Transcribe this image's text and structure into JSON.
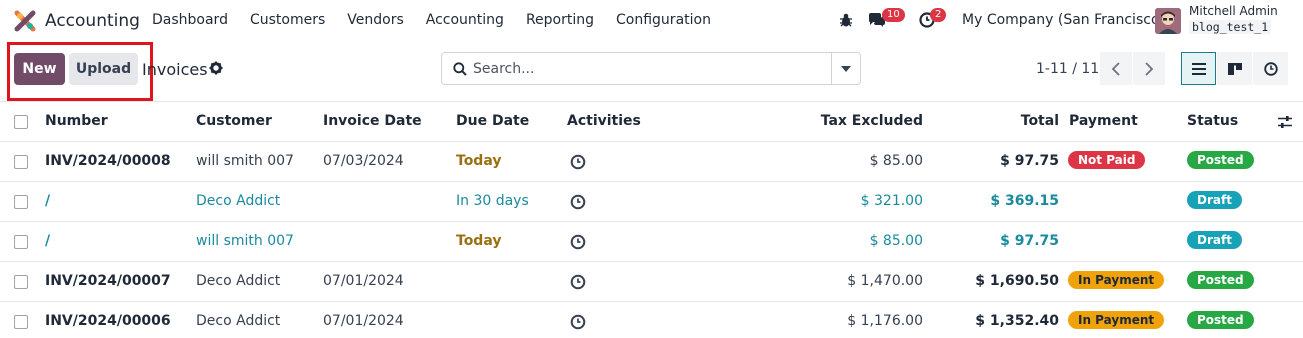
{
  "navbar": {
    "app_name": "Accounting",
    "menu": [
      "Dashboard",
      "Customers",
      "Vendors",
      "Accounting",
      "Reporting",
      "Configuration"
    ],
    "chat_count": "10",
    "activity_count": "2",
    "company": "My Company (San Francisco)",
    "user_name": "Mitchell Admin",
    "db_name": "blog_test_1"
  },
  "control": {
    "new_label": "New",
    "upload_label": "Upload",
    "title": "Invoices",
    "search_placeholder": "Search...",
    "pager": "1-11 / 11"
  },
  "table": {
    "columns": {
      "number": "Number",
      "customer": "Customer",
      "invoice_date": "Invoice Date",
      "due_date": "Due Date",
      "activities": "Activities",
      "tax_excluded": "Tax Excluded",
      "total": "Total",
      "payment": "Payment",
      "status": "Status"
    },
    "rows": [
      {
        "number": "INV/2024/00008",
        "customer": "will smith 007",
        "invoice_date": "07/03/2024",
        "due_date": "Today",
        "tax_excluded": "$ 85.00",
        "total": "$ 97.75",
        "payment": "Not Paid",
        "status": "Posted"
      },
      {
        "number": "/",
        "customer": "Deco Addict",
        "invoice_date": "",
        "due_date": "In 30 days",
        "tax_excluded": "$ 321.00",
        "total": "$ 369.15",
        "payment": "",
        "status": "Draft"
      },
      {
        "number": "/",
        "customer": "will smith 007",
        "invoice_date": "",
        "due_date": "Today",
        "tax_excluded": "$ 85.00",
        "total": "$ 97.75",
        "payment": "",
        "status": "Draft"
      },
      {
        "number": "INV/2024/00007",
        "customer": "Deco Addict",
        "invoice_date": "07/01/2024",
        "due_date": "",
        "tax_excluded": "$ 1,470.00",
        "total": "$ 1,690.50",
        "payment": "In Payment",
        "status": "Posted"
      },
      {
        "number": "INV/2024/00006",
        "customer": "Deco Addict",
        "invoice_date": "07/01/2024",
        "due_date": "",
        "tax_excluded": "$ 1,176.00",
        "total": "$ 1,352.40",
        "payment": "In Payment",
        "status": "Posted"
      }
    ]
  },
  "colors": {
    "brand": "#714b67",
    "highlight": "#e1141e",
    "not_paid": "#dc3545",
    "in_payment": "#f0a20a",
    "posted": "#28a745",
    "draft": "#17a2b8"
  }
}
